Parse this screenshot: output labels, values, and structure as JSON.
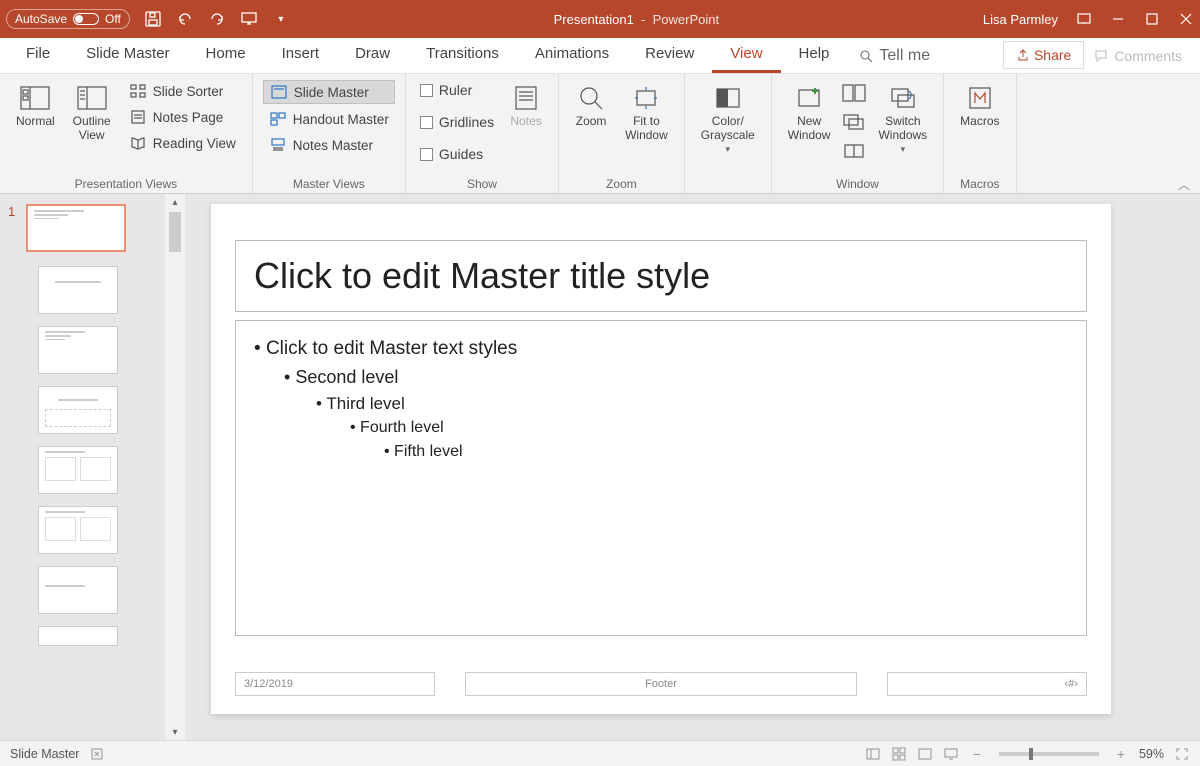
{
  "titlebar": {
    "autosave_label": "AutoSave",
    "autosave_state": "Off",
    "doc_name": "Presentation1",
    "app_name": "PowerPoint",
    "user": "Lisa Parmley"
  },
  "tabs": {
    "file": "File",
    "slide_master": "Slide Master",
    "home": "Home",
    "insert": "Insert",
    "draw": "Draw",
    "transitions": "Transitions",
    "animations": "Animations",
    "review": "Review",
    "view": "View",
    "help": "Help",
    "tell_me": "Tell me",
    "share": "Share",
    "comments": "Comments"
  },
  "ribbon": {
    "presentation_views": {
      "label": "Presentation Views",
      "normal": "Normal",
      "outline_view": "Outline\nView",
      "slide_sorter": "Slide Sorter",
      "notes_page": "Notes Page",
      "reading_view": "Reading View"
    },
    "master_views": {
      "label": "Master Views",
      "slide_master": "Slide Master",
      "handout_master": "Handout Master",
      "notes_master": "Notes Master"
    },
    "show": {
      "label": "Show",
      "ruler": "Ruler",
      "gridlines": "Gridlines",
      "guides": "Guides",
      "notes": "Notes"
    },
    "zoom": {
      "label": "Zoom",
      "zoom_btn": "Zoom",
      "fit": "Fit to\nWindow"
    },
    "color": {
      "label": "Color/\nGrayscale"
    },
    "window": {
      "label": "Window",
      "new_window": "New\nWindow",
      "switch_windows": "Switch\nWindows"
    },
    "macros": {
      "label": "Macros",
      "btn": "Macros"
    }
  },
  "thumbnails": {
    "slide1_num": "1"
  },
  "slide": {
    "title": "Click to edit Master title style",
    "l1": "Click to edit Master text styles",
    "l2": "Second level",
    "l3": "Third level",
    "l4": "Fourth level",
    "l5": "Fifth level",
    "date": "3/12/2019",
    "footer": "Footer",
    "slidenum": "‹#›"
  },
  "statusbar": {
    "mode": "Slide Master",
    "zoom": "59%"
  }
}
